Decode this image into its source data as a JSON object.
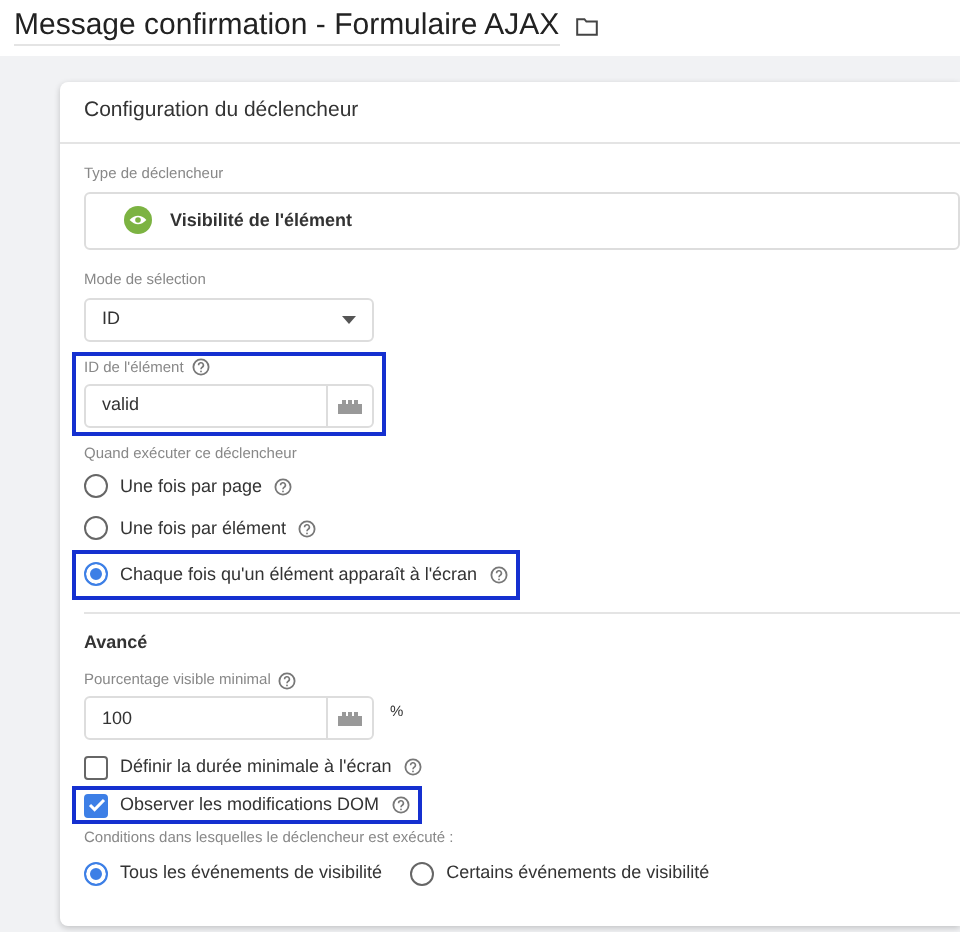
{
  "title": "Message confirmation - Formulaire AJAX",
  "card": {
    "title": "Configuration du déclencheur",
    "trigger_type": {
      "label": "Type de déclencheur",
      "value": "Visibilité de l'élément"
    },
    "selection_mode": {
      "label": "Mode de sélection",
      "value": "ID"
    },
    "element_id": {
      "label": "ID de l'élément",
      "value": "valid",
      "highlighted": true
    },
    "when_to_fire": {
      "label": "Quand exécuter ce déclencheur",
      "options": [
        {
          "label": "Une fois par page",
          "selected": false,
          "highlighted": false
        },
        {
          "label": "Une fois par élément",
          "selected": false,
          "highlighted": false
        },
        {
          "label": "Chaque fois qu'un élément apparaît à l'écran",
          "selected": true,
          "highlighted": true
        }
      ]
    },
    "advanced": {
      "heading": "Avancé",
      "min_percent": {
        "label": "Pourcentage visible minimal",
        "value": "100",
        "unit": "%"
      },
      "checkboxes": [
        {
          "label": "Définir la durée minimale à l'écran",
          "checked": false,
          "highlighted": false
        },
        {
          "label": "Observer les modifications DOM",
          "checked": true,
          "highlighted": true
        }
      ],
      "conditions": {
        "label": "Conditions dans lesquelles le déclencheur est exécuté :",
        "options": [
          {
            "label": "Tous les événements de visibilité",
            "selected": true
          },
          {
            "label": "Certains événements de visibilité",
            "selected": false
          }
        ]
      }
    }
  }
}
